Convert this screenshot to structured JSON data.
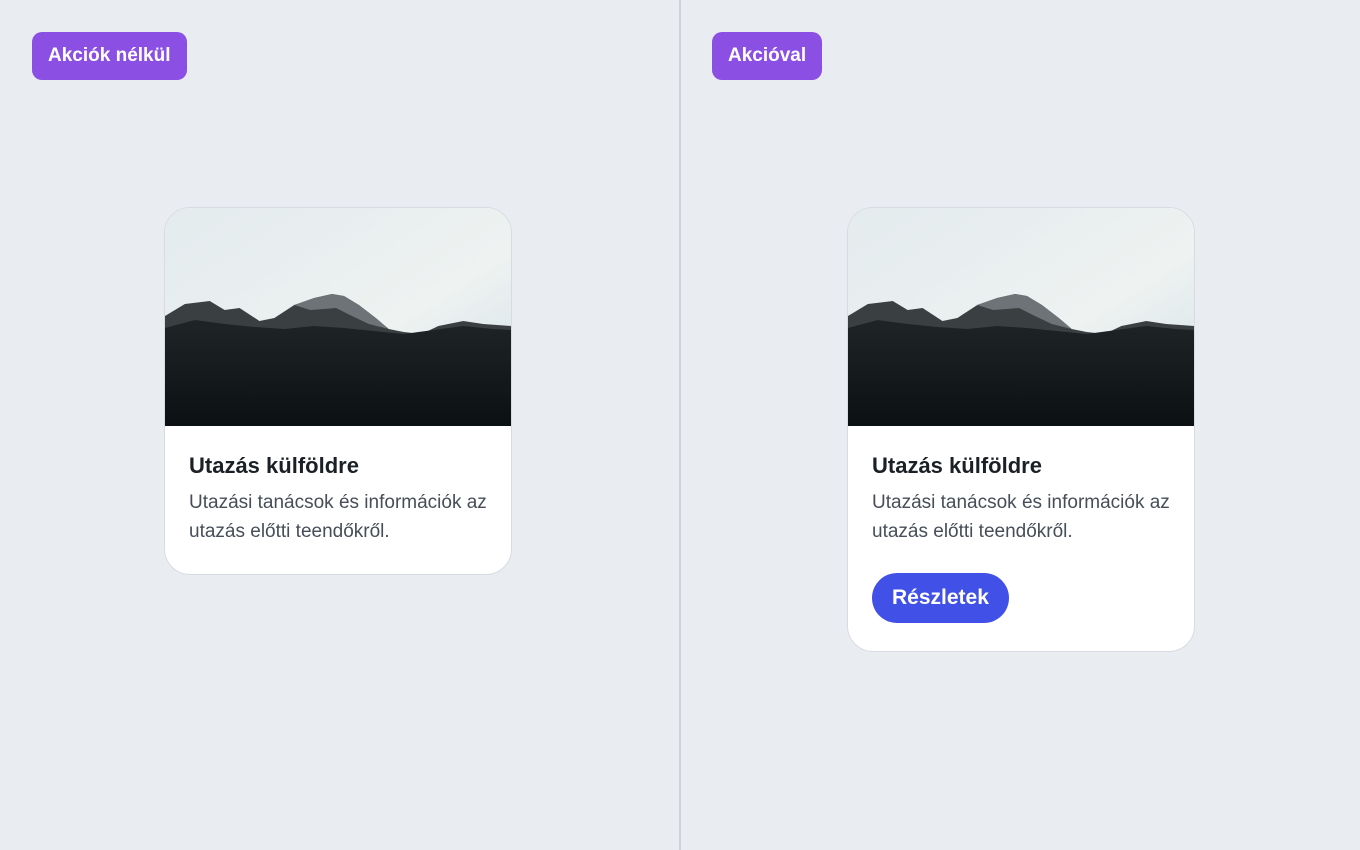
{
  "left_panel": {
    "badge": "Akciók nélkül",
    "card": {
      "title": "Utazás külföldre",
      "description": "Utazási tanácsok és információk az utazás előtti teendőkről."
    }
  },
  "right_panel": {
    "badge": "Akcióval",
    "card": {
      "title": "Utazás külföldre",
      "description": "Utazási tanácsok és információk az utazás előtti teendőkről.",
      "action_label": "Részletek"
    }
  },
  "colors": {
    "background": "#e9ecf1",
    "badge": "#8b4fe3",
    "primary_button": "#4150e6",
    "title_text": "#1b2026",
    "body_text": "#474e58"
  }
}
